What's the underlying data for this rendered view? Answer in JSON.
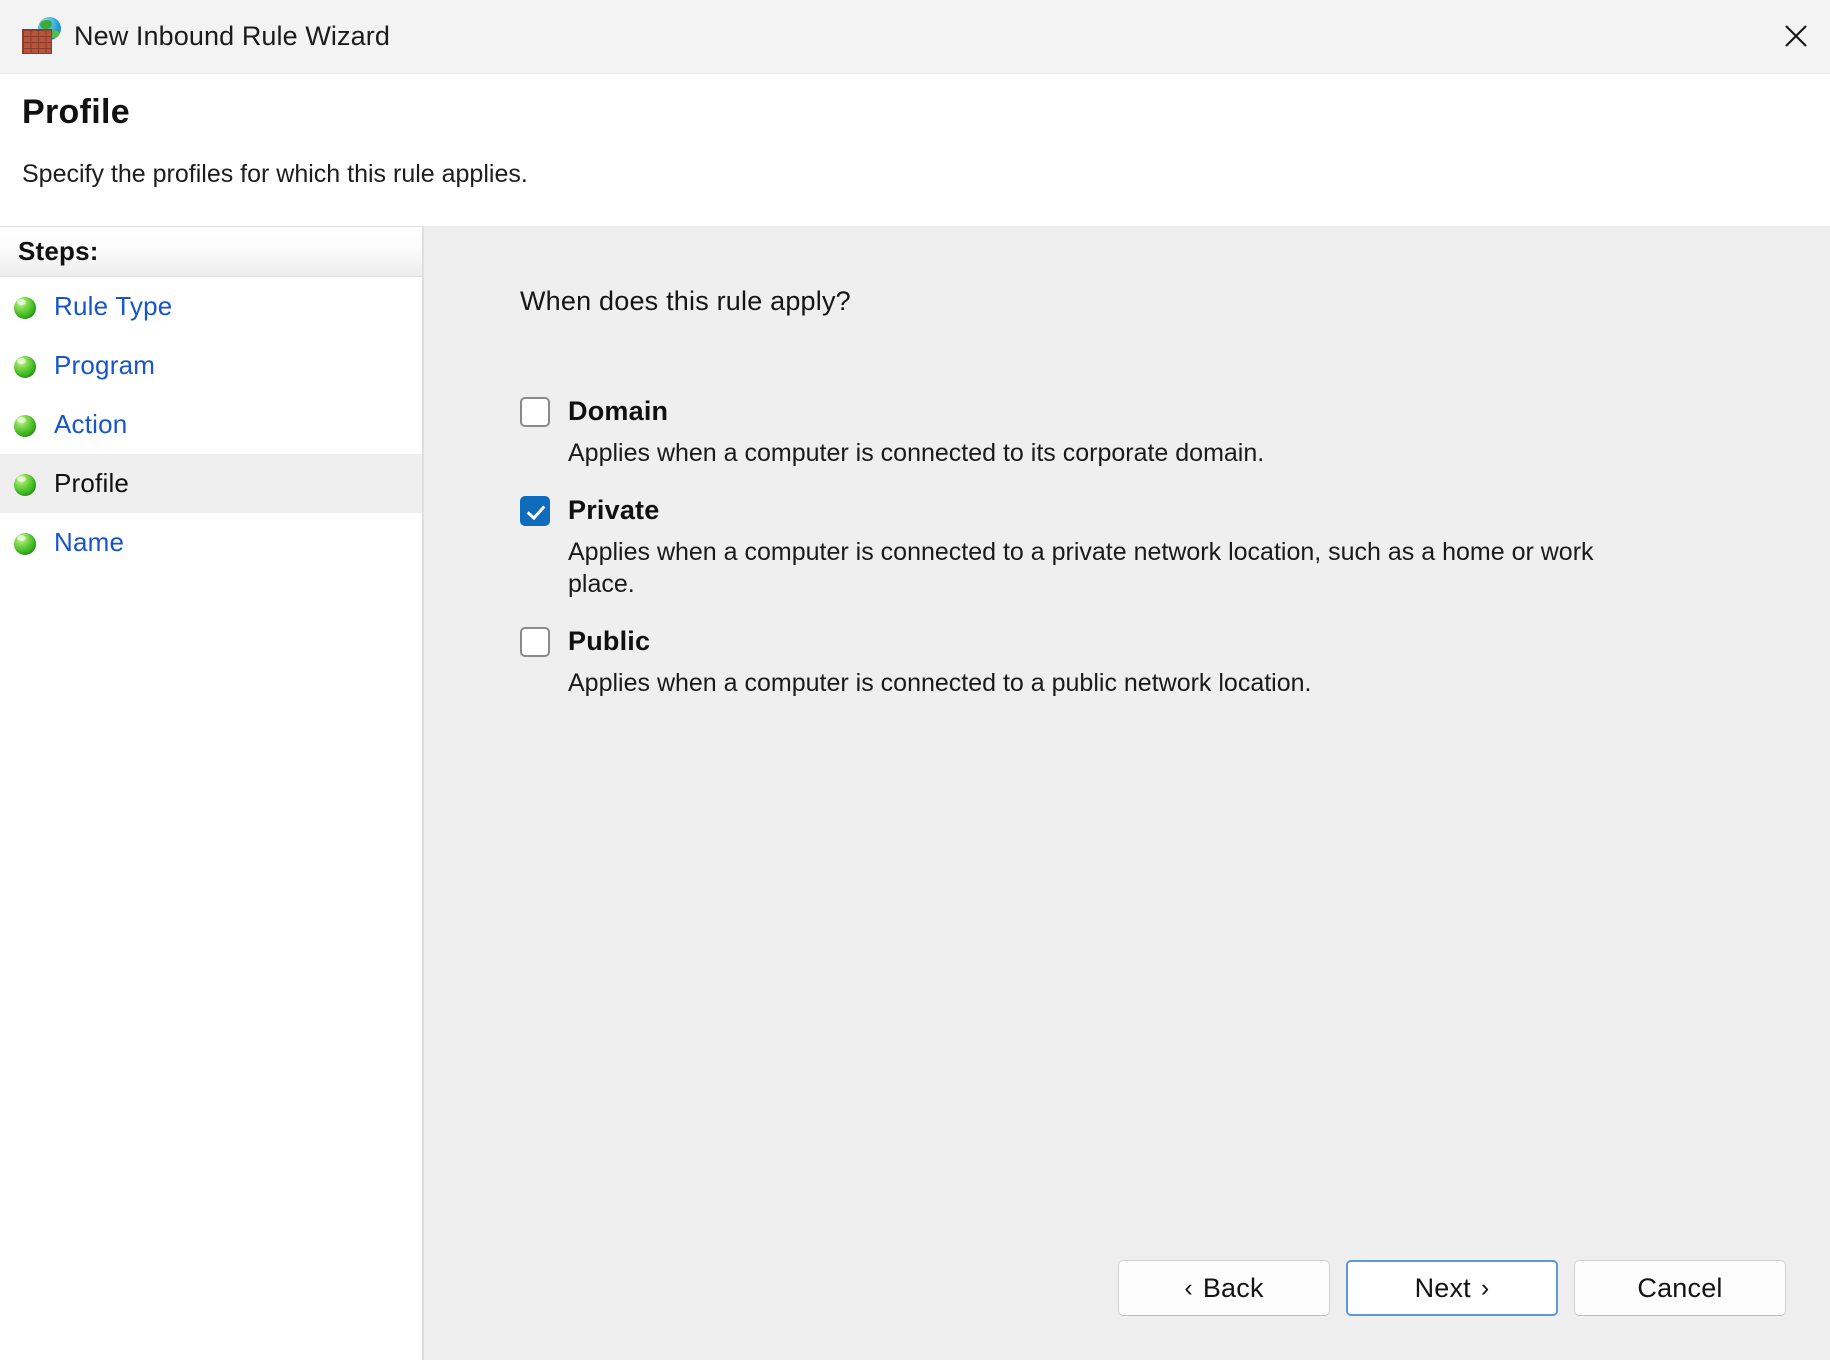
{
  "window": {
    "title": "New Inbound Rule Wizard",
    "icon": "firewall-icon",
    "close_label": "✕"
  },
  "header": {
    "title": "Profile",
    "subtitle": "Specify the profiles for which this rule applies."
  },
  "sidebar": {
    "header": "Steps:",
    "items": [
      {
        "label": "Rule Type",
        "icon": "green-bullet-icon",
        "active": false
      },
      {
        "label": "Program",
        "icon": "green-bullet-icon",
        "active": false
      },
      {
        "label": "Action",
        "icon": "green-bullet-icon",
        "active": false
      },
      {
        "label": "Profile",
        "icon": "green-bullet-icon",
        "active": true
      },
      {
        "label": "Name",
        "icon": "green-bullet-icon",
        "active": false
      }
    ]
  },
  "main": {
    "question": "When does this rule apply?",
    "options": [
      {
        "label": "Domain",
        "checked": false,
        "description": "Applies when a computer is connected to its corporate domain."
      },
      {
        "label": "Private",
        "checked": true,
        "description": "Applies when a computer is connected to a private network location, such as a home or work place."
      },
      {
        "label": "Public",
        "checked": false,
        "description": "Applies when a computer is connected to a public network location."
      }
    ]
  },
  "footer": {
    "back_label": "Back",
    "back_chevron": "‹",
    "next_label": "Next",
    "next_chevron": "›",
    "cancel_label": "Cancel"
  },
  "colors": {
    "titlebar_bg": "#F3F3F3",
    "content_bg": "#EFEFEF",
    "link": "#1756C9",
    "checkbox_accent": "#0F6CBD",
    "default_button_border": "#5B9BD5"
  }
}
